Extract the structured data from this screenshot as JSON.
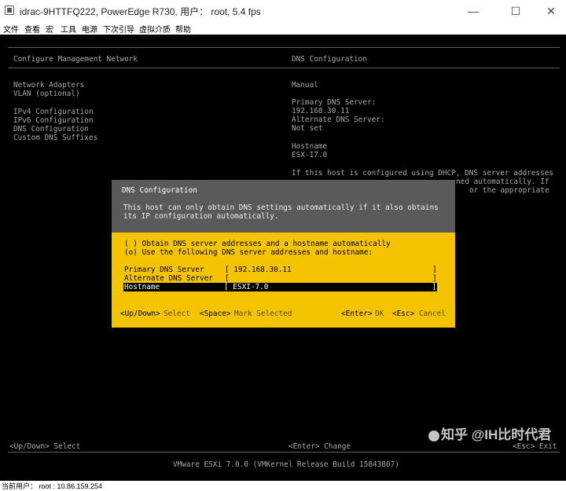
{
  "window": {
    "title": "idrac-9HTTFQ222, PowerEdge R730, 用户： root, 5.4 fps",
    "icons": [
      "app-icon",
      "minimize-icon",
      "maximize-icon",
      "close-icon"
    ]
  },
  "menu": [
    "文件",
    "查看",
    "宏",
    "工具",
    "电源",
    "下次引导",
    "虚拟介质",
    "帮助"
  ],
  "console": {
    "left_header": "Configure Management Network",
    "right_header": "DNS Configuration",
    "left_menu": [
      "Network Adapters",
      "VLAN (optional)",
      "",
      "IPv4 Configuration",
      "IPv6 Configuration",
      "DNS Configuration",
      "Custom DNS Suffixes"
    ],
    "right_mode": "Manual",
    "primary_dns_label": "Primary DNS Server:",
    "primary_dns_value": "192.168.30.11",
    "alternate_dns_label": "Alternate DNS Server:",
    "alternate_dns_value": "Not set",
    "hostname_label": "Hostname",
    "hostname_value": "ESX-17.0",
    "help_line1": "If this host is configured using DHCP, DNS server addresses",
    "help_line2": "ned automatically. If",
    "help_line3": "or the appropriate",
    "footer_left": "<Up/Down> Select",
    "footer_mid": "<Enter> Change",
    "footer_right": "<Esc> Exit",
    "build": "VMware ESXi 7.0.0 (VMKernel Release Build 15843807)"
  },
  "dialog": {
    "title": "DNS Configuration",
    "desc_line1": "This host can only obtain DNS settings automatically if it also obtains",
    "desc_line2": "its IP configuration automatically.",
    "option_auto": "( ) Obtain DNS server addresses and a hostname automatically",
    "option_manual": "(o) Use the following DNS server addresses and hostname:",
    "primary_label": "Primary DNS Server",
    "primary_value": "[ 192.168.30.11",
    "alternate_label": "Alternate DNS Server",
    "alternate_value": "[",
    "hostname_label": "Hostname",
    "hostname_value": "[ ESXI-7.0",
    "bracket_close": "]",
    "key_updown": "<Up/Down>",
    "act_select": "Select",
    "key_space": "<Space>",
    "act_mark": "Mark Selected",
    "key_enter": "<Enter>",
    "act_ok": "OK",
    "key_esc": "<Esc>",
    "act_cancel": "Cancel"
  },
  "status": "当前用户： root : 10.86.159.254",
  "watermark": "知乎 @IH比时代君",
  "colors": {
    "console_bg": "#000000",
    "dialog_header": "#5a5a5a",
    "dialog_body": "#f5c400",
    "console_text": "#a8a8a8"
  }
}
